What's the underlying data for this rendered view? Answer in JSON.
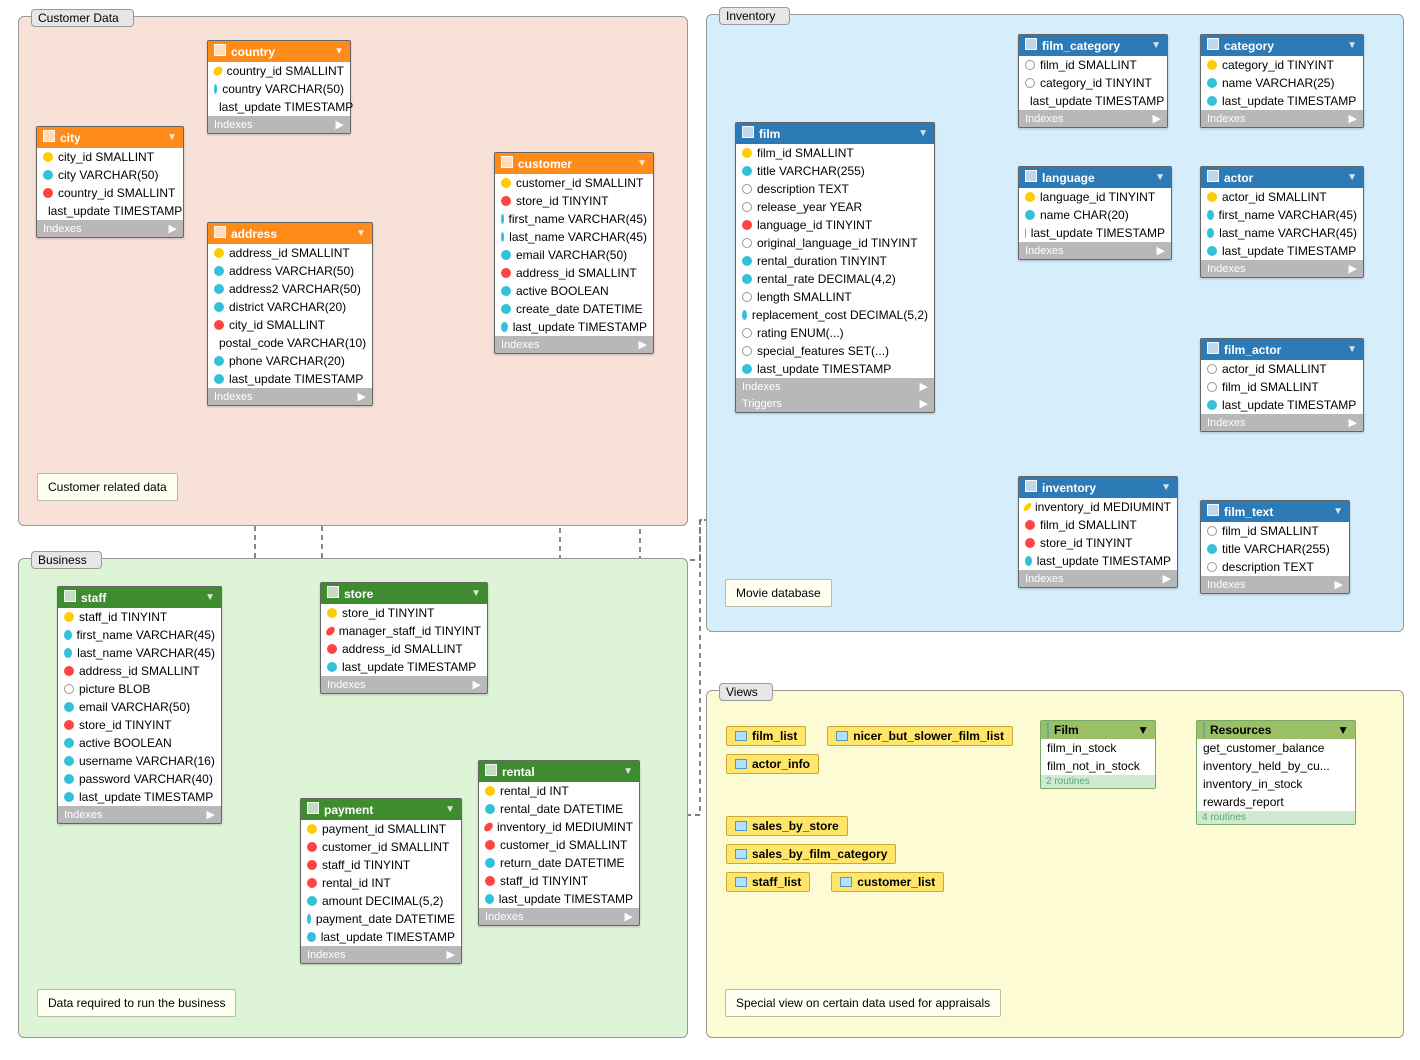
{
  "regions": {
    "customer": {
      "label": "Customer Data",
      "note": "Customer related data"
    },
    "business": {
      "label": "Business",
      "note": "Data required to run the business"
    },
    "inventory": {
      "label": "Inventory",
      "note": "Movie database"
    },
    "views": {
      "label": "Views",
      "note": "Special view on certain data used for appraisals"
    }
  },
  "footers": {
    "indexes": "Indexes",
    "triggers": "Triggers"
  },
  "tables": {
    "country": {
      "head": "country",
      "cols": [
        [
          "pk",
          "country_id SMALLINT"
        ],
        [
          "idx",
          "country VARCHAR(50)"
        ],
        [
          "idx",
          "last_update TIMESTAMP"
        ]
      ]
    },
    "city": {
      "head": "city",
      "cols": [
        [
          "pk",
          "city_id SMALLINT"
        ],
        [
          "idx",
          "city VARCHAR(50)"
        ],
        [
          "fk",
          "country_id SMALLINT"
        ],
        [
          "idx",
          "last_update TIMESTAMP"
        ]
      ]
    },
    "address": {
      "head": "address",
      "cols": [
        [
          "pk",
          "address_id SMALLINT"
        ],
        [
          "idx",
          "address VARCHAR(50)"
        ],
        [
          "idx",
          "address2 VARCHAR(50)"
        ],
        [
          "idx",
          "district VARCHAR(20)"
        ],
        [
          "fk",
          "city_id SMALLINT"
        ],
        [
          "idx",
          "postal_code VARCHAR(10)"
        ],
        [
          "idx",
          "phone VARCHAR(20)"
        ],
        [
          "idx",
          "last_update TIMESTAMP"
        ]
      ]
    },
    "customer": {
      "head": "customer",
      "cols": [
        [
          "pk",
          "customer_id SMALLINT"
        ],
        [
          "fk",
          "store_id TINYINT"
        ],
        [
          "idx",
          "first_name VARCHAR(45)"
        ],
        [
          "idx",
          "last_name VARCHAR(45)"
        ],
        [
          "idx",
          "email VARCHAR(50)"
        ],
        [
          "fk",
          "address_id SMALLINT"
        ],
        [
          "idx",
          "active BOOLEAN"
        ],
        [
          "idx",
          "create_date DATETIME"
        ],
        [
          "idx",
          "last_update TIMESTAMP"
        ]
      ]
    },
    "staff": {
      "head": "staff",
      "cols": [
        [
          "pk",
          "staff_id TINYINT"
        ],
        [
          "idx",
          "first_name VARCHAR(45)"
        ],
        [
          "idx",
          "last_name VARCHAR(45)"
        ],
        [
          "fk",
          "address_id SMALLINT"
        ],
        [
          "col",
          "picture BLOB"
        ],
        [
          "idx",
          "email VARCHAR(50)"
        ],
        [
          "fk",
          "store_id TINYINT"
        ],
        [
          "idx",
          "active BOOLEAN"
        ],
        [
          "idx",
          "username VARCHAR(16)"
        ],
        [
          "idx",
          "password VARCHAR(40)"
        ],
        [
          "idx",
          "last_update TIMESTAMP"
        ]
      ]
    },
    "store": {
      "head": "store",
      "cols": [
        [
          "pk",
          "store_id TINYINT"
        ],
        [
          "fk",
          "manager_staff_id TINYINT"
        ],
        [
          "fk",
          "address_id SMALLINT"
        ],
        [
          "idx",
          "last_update TIMESTAMP"
        ]
      ]
    },
    "payment": {
      "head": "payment",
      "cols": [
        [
          "pk",
          "payment_id SMALLINT"
        ],
        [
          "fk",
          "customer_id SMALLINT"
        ],
        [
          "fk",
          "staff_id TINYINT"
        ],
        [
          "fk",
          "rental_id INT"
        ],
        [
          "idx",
          "amount DECIMAL(5,2)"
        ],
        [
          "idx",
          "payment_date DATETIME"
        ],
        [
          "idx",
          "last_update TIMESTAMP"
        ]
      ]
    },
    "rental": {
      "head": "rental",
      "cols": [
        [
          "pk",
          "rental_id INT"
        ],
        [
          "idx",
          "rental_date DATETIME"
        ],
        [
          "fk",
          "inventory_id MEDIUMINT"
        ],
        [
          "fk",
          "customer_id SMALLINT"
        ],
        [
          "idx",
          "return_date DATETIME"
        ],
        [
          "fk",
          "staff_id TINYINT"
        ],
        [
          "idx",
          "last_update TIMESTAMP"
        ]
      ]
    },
    "film": {
      "head": "film",
      "cols": [
        [
          "pk",
          "film_id SMALLINT"
        ],
        [
          "idx",
          "title VARCHAR(255)"
        ],
        [
          "col",
          "description TEXT"
        ],
        [
          "col",
          "release_year YEAR"
        ],
        [
          "fk",
          "language_id TINYINT"
        ],
        [
          "col",
          "original_language_id TINYINT"
        ],
        [
          "idx",
          "rental_duration TINYINT"
        ],
        [
          "idx",
          "rental_rate DECIMAL(4,2)"
        ],
        [
          "col",
          "length SMALLINT"
        ],
        [
          "idx",
          "replacement_cost DECIMAL(5,2)"
        ],
        [
          "col",
          "rating ENUM(...)"
        ],
        [
          "col",
          "special_features SET(...)"
        ],
        [
          "idx",
          "last_update TIMESTAMP"
        ]
      ]
    },
    "film_category": {
      "head": "film_category",
      "cols": [
        [
          "",
          "film_id SMALLINT"
        ],
        [
          "",
          "category_id TINYINT"
        ],
        [
          "idx",
          "last_update TIMESTAMP"
        ]
      ]
    },
    "category": {
      "head": "category",
      "cols": [
        [
          "pk",
          "category_id TINYINT"
        ],
        [
          "idx",
          "name VARCHAR(25)"
        ],
        [
          "idx",
          "last_update TIMESTAMP"
        ]
      ]
    },
    "language": {
      "head": "language",
      "cols": [
        [
          "pk",
          "language_id TINYINT"
        ],
        [
          "idx",
          "name CHAR(20)"
        ],
        [
          "idx",
          "last_update TIMESTAMP"
        ]
      ]
    },
    "actor": {
      "head": "actor",
      "cols": [
        [
          "pk",
          "actor_id SMALLINT"
        ],
        [
          "idx",
          "first_name VARCHAR(45)"
        ],
        [
          "idx",
          "last_name VARCHAR(45)"
        ],
        [
          "idx",
          "last_update TIMESTAMP"
        ]
      ]
    },
    "film_actor": {
      "head": "film_actor",
      "cols": [
        [
          "",
          "actor_id SMALLINT"
        ],
        [
          "",
          "film_id SMALLINT"
        ],
        [
          "idx",
          "last_update TIMESTAMP"
        ]
      ]
    },
    "inventory": {
      "head": "inventory",
      "cols": [
        [
          "pk",
          "inventory_id MEDIUMINT"
        ],
        [
          "fk",
          "film_id SMALLINT"
        ],
        [
          "fk",
          "store_id TINYINT"
        ],
        [
          "idx",
          "last_update TIMESTAMP"
        ]
      ]
    },
    "film_text": {
      "head": "film_text",
      "cols": [
        [
          "",
          "film_id SMALLINT"
        ],
        [
          "idx",
          "title VARCHAR(255)"
        ],
        [
          "col",
          "description TEXT"
        ]
      ]
    }
  },
  "views": {
    "buttons": [
      "film_list",
      "nicer_but_slower_film_list",
      "actor_info",
      "sales_by_store",
      "sales_by_film_category",
      "staff_list",
      "customer_list"
    ],
    "filmgrp": {
      "head": "Film",
      "rows": [
        "film_in_stock",
        "film_not_in_stock"
      ],
      "foot": "2 routines"
    },
    "resgrp": {
      "head": "Resources",
      "rows": [
        "get_customer_balance",
        "inventory_held_by_cu...",
        "inventory_in_stock",
        "rewards_report"
      ],
      "foot": "4 routines"
    }
  }
}
